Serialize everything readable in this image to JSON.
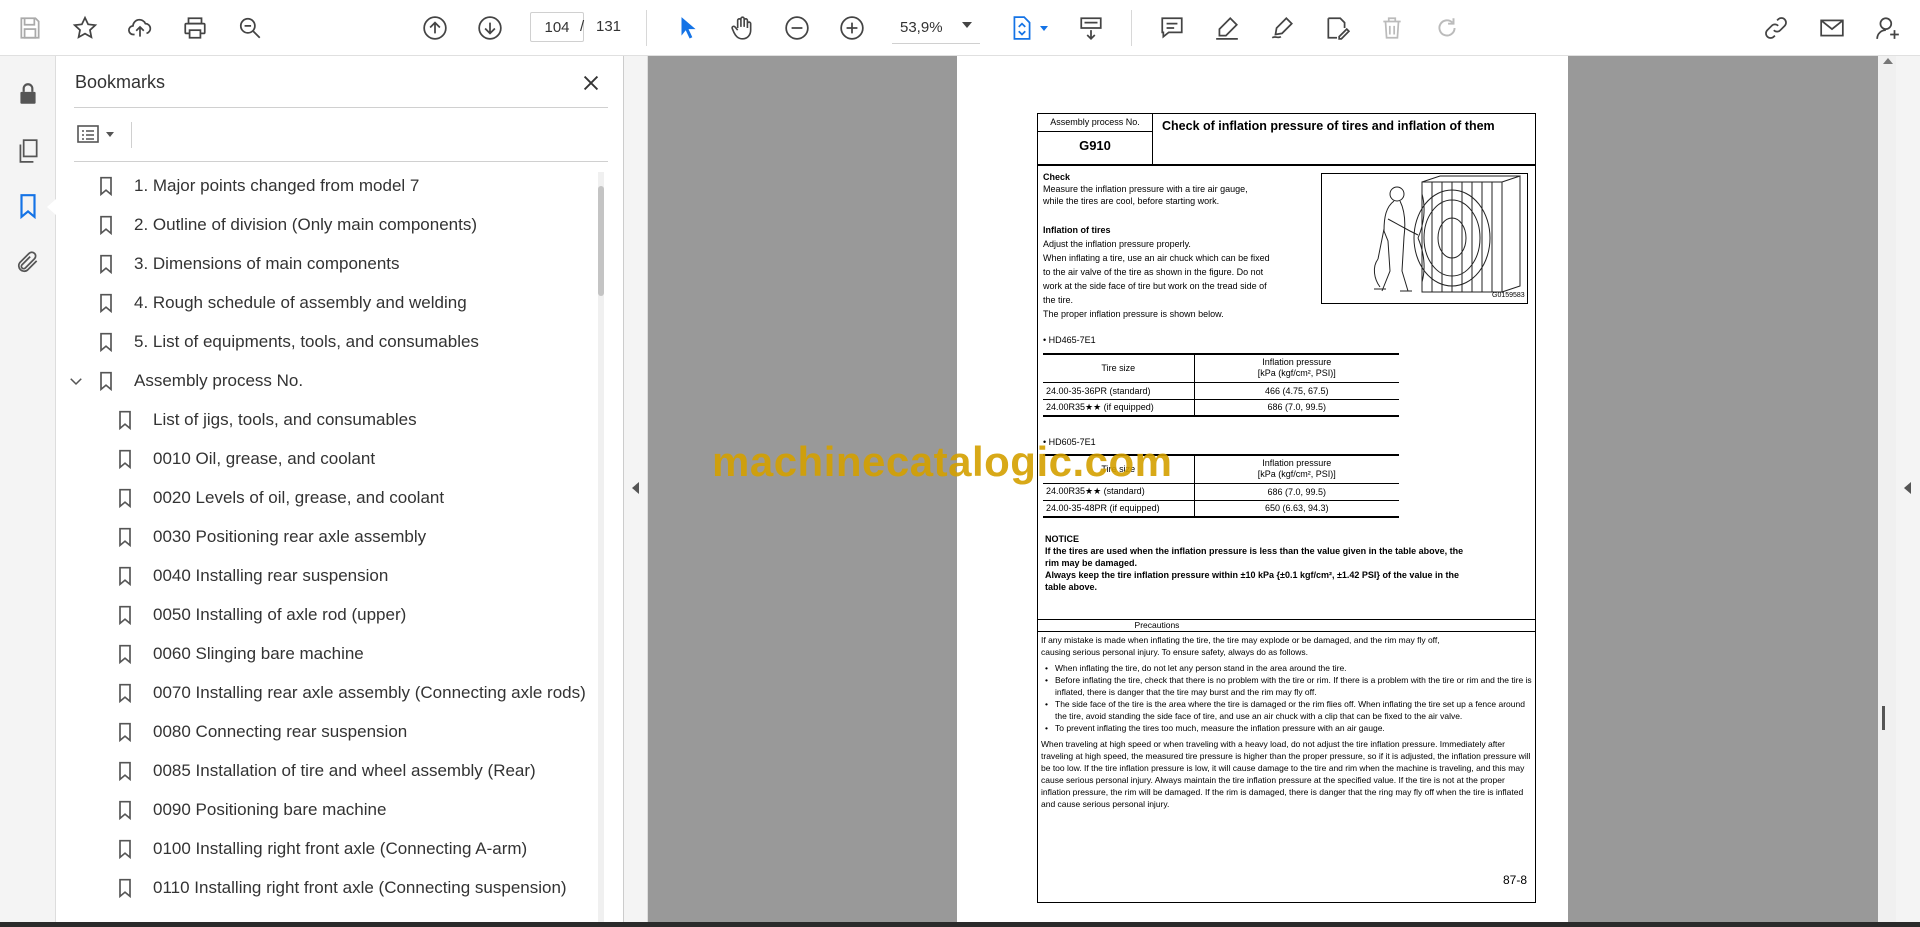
{
  "toolbar": {
    "current_page": "104",
    "page_separator": "/",
    "total_pages": "131",
    "zoom": "53,9%"
  },
  "bookmarks": {
    "title": "Bookmarks",
    "items": [
      {
        "label": "1. Major points changed from model 7"
      },
      {
        "label": "2. Outline of division (Only main components)"
      },
      {
        "label": "3. Dimensions of main components"
      },
      {
        "label": "4. Rough schedule of assembly and welding"
      },
      {
        "label": "5. List of equipments, tools, and consumables"
      },
      {
        "label": "Assembly process No."
      },
      {
        "label": "List of jigs, tools, and consumables"
      },
      {
        "label": "0010 Oil, grease, and coolant"
      },
      {
        "label": "0020 Levels of oil, grease, and coolant"
      },
      {
        "label": "0030 Positioning rear axle assembly"
      },
      {
        "label": "0040 Installing rear suspension"
      },
      {
        "label": "0050 Installing of axle rod (upper)"
      },
      {
        "label": "0060 Slinging bare machine"
      },
      {
        "label": "0070 Installing rear axle assembly (Connecting axle rods)"
      },
      {
        "label": "0080 Connecting rear suspension"
      },
      {
        "label": "0085 Installation of tire and wheel assembly (Rear)"
      },
      {
        "label": "0090 Positioning bare machine"
      },
      {
        "label": "0100 Installing right front axle (Connecting A-arm)"
      },
      {
        "label": "0110 Installing right front axle (Connecting suspension)"
      }
    ]
  },
  "document": {
    "process_no_label": "Assembly process No.",
    "process_no": "G910",
    "heading": "Check of inflation pressure of tires and inflation of them",
    "check_title": "Check",
    "check_text1": "Measure the inflation pressure with a tire air gauge,",
    "check_text2": "while the tires are cool, before starting work.",
    "inflation_title": "Inflation of tires",
    "inflation_lines": [
      "Adjust the inflation pressure properly.",
      "When inflating a tire, use an air chuck which can be fixed",
      "to the air valve of the tire as shown in the figure. Do not",
      "work at the side face of tire but work on the tread side of",
      "the tire.",
      "The proper inflation pressure is shown below."
    ],
    "figure_code": "G0159583",
    "table1_model": "HD465-7E1",
    "table_head_size": "Tire size",
    "table_head_pressure1": "Inflation pressure",
    "table_head_pressure2": "[kPa (kgf/cm², PSI)]",
    "table1_rows": [
      {
        "size": "24.00-35-36PR (standard)",
        "pressure": "466 (4.75, 67.5)"
      },
      {
        "size": "24.00R35★★ (if equipped)",
        "pressure": "686 (7.0, 99.5)"
      }
    ],
    "table2_model": "HD605-7E1",
    "table2_rows": [
      {
        "size": "24.00R35★★ (standard)",
        "pressure": "686 (7.0, 99.5)"
      },
      {
        "size": "24.00-35-48PR (if equipped)",
        "pressure": "650 (6.63, 94.3)"
      }
    ],
    "notice_title": "NOTICE",
    "notice_line1": "If the tires are used when the inflation pressure is less than the value given in the table above, the",
    "notice_line2": "rim may be damaged.",
    "notice_line3": "Always keep the tire inflation pressure within ±10 kPa {±0.1 kgf/cm², ±1.42 PSI} of the value in the",
    "notice_line4": "table above.",
    "precautions_title": "Precautions",
    "prec_intro1": "If any mistake is made when inflating the tire, the tire may explode or be damaged, and the rim may fly off,",
    "prec_intro2": "causing serious personal injury. To ensure safety, always do as follows.",
    "prec_bullets": [
      "When inflating the tire, do not let any person stand in the area around the tire.",
      "Before inflating the tire, check that there is no problem with the tire or rim. If there is a problem with the tire or rim and the tire is inflated, there is danger that the tire may burst and the rim may fly off.",
      "The side face of the tire is the area where the tire is damaged or the rim flies off. When inflating the tire set up a fence around the tire, avoid standing the side face of tire, and use an air chuck with a clip that can be fixed to the air valve.",
      "To prevent inflating the tires too much, measure the inflation pressure with an air gauge."
    ],
    "prec_para": "When traveling at high speed or when traveling with a heavy load, do not adjust the tire inflation pressure. Immediately after traveling at high speed, the measured tire pressure is higher than the proper pressure, so if it is adjusted, the inflation pressure will be too low. If the tire inflation pressure is low, it will cause damage to the tire and rim when the machine is traveling, and this may cause serious personal injury. Always maintain the tire inflation pressure at the specified value. If the tire is not at the proper inflation pressure, the rim will be damaged. If the rim is damaged, there is danger that the ring may fly off when the tire is inflated and cause serious personal injury.",
    "page_number": "87-8"
  },
  "watermark": "machinecatalogic.com"
}
